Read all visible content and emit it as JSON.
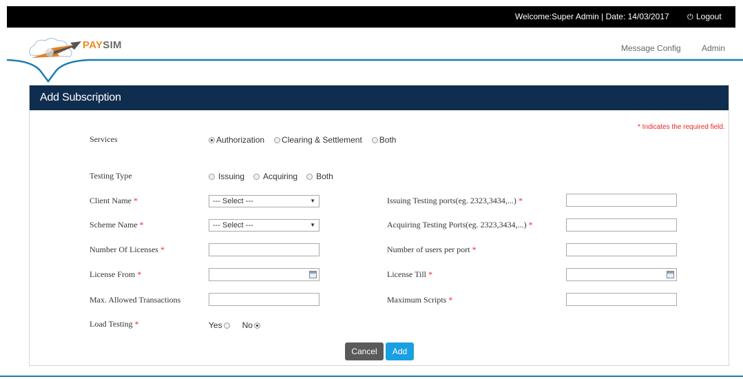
{
  "topbar": {
    "welcome": "Welcome:Super Admin  |  Date: 14/03/2017",
    "logout": "Logout"
  },
  "brand": {
    "pay": "PAY",
    "sim": "SIM"
  },
  "nav": {
    "message_config": "Message Config",
    "admin": "Admin"
  },
  "page_title": "Add Subscription",
  "required_note": "* Indicates the required field.",
  "services": {
    "label": "Services",
    "options": [
      "Authorization",
      "Clearing & Settlement",
      "Both"
    ],
    "selected": "Authorization"
  },
  "testing_type": {
    "label": "Testing Type",
    "options": [
      "Issuing",
      "Acquiring",
      "Both"
    ]
  },
  "form": {
    "client_name": {
      "label": "Client Name",
      "value": "--- Select ---"
    },
    "scheme_name": {
      "label": "Scheme Name",
      "value": "--- Select ---"
    },
    "number_of_licenses": {
      "label": "Number Of Licenses"
    },
    "license_from": {
      "label": "License From"
    },
    "max_allowed_transactions": {
      "label": "Max. Allowed Transactions"
    },
    "load_testing": {
      "label": "Load Testing",
      "yes": "Yes",
      "no": "No",
      "selected": "No"
    },
    "issuing_ports": {
      "label": "Issuing Testing ports(eg. 2323,3434,...)"
    },
    "acquiring_ports": {
      "label": "Acquiring Testing Ports(eg. 2323,3434,...)"
    },
    "users_per_port": {
      "label": "Number of users per port"
    },
    "license_till": {
      "label": "License Till"
    },
    "maximum_scripts": {
      "label": "Maximum Scripts"
    }
  },
  "buttons": {
    "cancel": "Cancel",
    "add": "Add"
  },
  "colors": {
    "panel_header": "#0f2d4e",
    "accent": "#1aa0e0",
    "required": "#e22222",
    "brand_orange": "#f08a24"
  }
}
